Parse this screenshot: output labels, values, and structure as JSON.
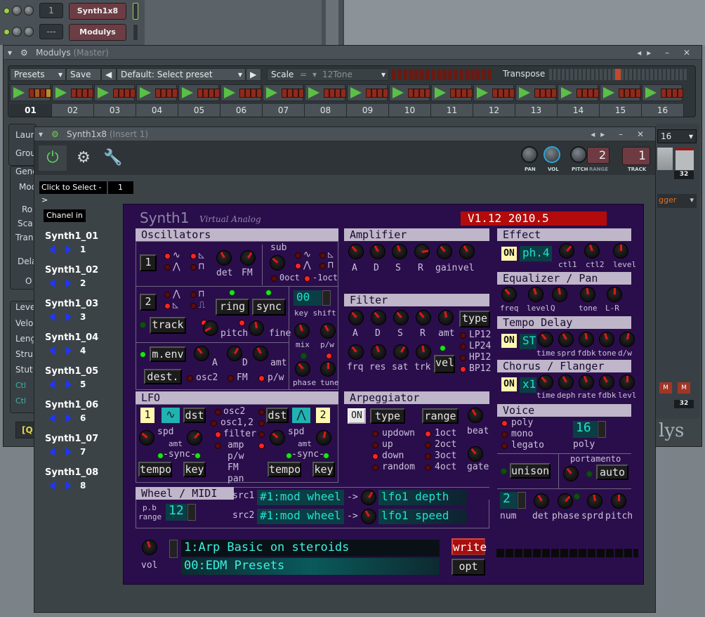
{
  "channel_rack": {
    "rows": [
      {
        "number": "1",
        "name": "Synth1x8"
      },
      {
        "number": "---",
        "name": "Modulys"
      }
    ]
  },
  "modulys_window": {
    "title": "Modulys",
    "title_suffix": "(Master)",
    "presets_label": "Presets",
    "save_label": "Save",
    "preset_name": "Default: Select preset",
    "scale_label": "Scale",
    "scale_value": "12Tone",
    "scale_eq": "=",
    "transpose_label": "Transpose",
    "tabs": [
      "01",
      "02",
      "03",
      "04",
      "05",
      "06",
      "07",
      "08",
      "09",
      "10",
      "11",
      "12",
      "13",
      "14",
      "15",
      "16"
    ],
    "left_labels": [
      "Laun",
      "Grou",
      "Gene",
      "Mod",
      "Ro",
      "Sca",
      "Tran",
      "Dela",
      "O",
      "Leve",
      "Velo",
      "Leng",
      "Stru",
      "Stut",
      "Ctl",
      "Ctl",
      "[Q"
    ],
    "right_panel": {
      "value": "16",
      "mini_num": "32",
      "mini_num2": "32",
      "trigger_text": "gger",
      "logo_fragment": "lys",
      "m_label": "M"
    }
  },
  "synth_window": {
    "title": "Synth1x8",
    "title_suffix": "(Insert 1)",
    "toolbar": {
      "pan_label": "PAN",
      "vol_label": "VOL",
      "pitch_label": "PITCH",
      "range_label": "RANGE",
      "range_value": "2",
      "track_label": "TRACK",
      "track_value": "1"
    },
    "click_to_select": "Click to Select ->",
    "select_value": "1",
    "chanel_in": "Chanel in",
    "channels": [
      {
        "name": "Synth1_01",
        "num": "1"
      },
      {
        "name": "Synth1_02",
        "num": "2"
      },
      {
        "name": "Synth1_03",
        "num": "3"
      },
      {
        "name": "Synth1_04",
        "num": "4"
      },
      {
        "name": "Synth1_05",
        "num": "5"
      },
      {
        "name": "Synth1_06",
        "num": "6"
      },
      {
        "name": "Synth1_07",
        "num": "7"
      },
      {
        "name": "Synth1_08",
        "num": "8"
      }
    ]
  },
  "synth1": {
    "title": "Synth1",
    "subtitle": "Virtual Analog",
    "version": "V1.12 2010.5",
    "osc": {
      "title": "Oscillators",
      "osc1": "1",
      "osc2": "2",
      "sub": "sub",
      "det": "det",
      "fm": "FM",
      "oct0": "0oct",
      "octm1": "-1oct",
      "ring": "ring",
      "sync": "sync",
      "track": "track",
      "pitch": "pitch",
      "fine": "fine",
      "key_value": "00",
      "key_shift": "key shift",
      "mix": "mix",
      "pw": "p/w",
      "menv": "m.env",
      "a": "A",
      "d": "D",
      "amt": "amt",
      "dest": "dest.",
      "osc2_opt": "osc2",
      "fm_opt": "FM",
      "pw_opt": "p/w",
      "phase": "phase",
      "tune": "tune"
    },
    "amp": {
      "title": "Amplifier",
      "labels": [
        "A",
        "D",
        "S",
        "R",
        "gain",
        "vel"
      ]
    },
    "filter": {
      "title": "Filter",
      "labels": [
        "A",
        "D",
        "S",
        "R",
        "amt"
      ],
      "type": "type",
      "labels2": [
        "frq",
        "res",
        "sat",
        "trk"
      ],
      "vel": "vel",
      "types": [
        "LP12",
        "LP24",
        "HP12",
        "BP12"
      ]
    },
    "effect": {
      "title": "Effect",
      "on": "ON",
      "type": "ph.4",
      "labels": [
        "ctl1",
        "ctl2",
        "level"
      ]
    },
    "eq": {
      "title": "Equalizer / Pan",
      "labels": [
        "freq",
        "level",
        "Q",
        "tone",
        "L-R"
      ]
    },
    "delay": {
      "title": "Tempo Delay",
      "on": "ON",
      "type": "ST",
      "labels": [
        "time",
        "sprd",
        "fdbk",
        "tone",
        "d/w"
      ]
    },
    "chorus": {
      "title": "Chorus / Flanger",
      "on": "ON",
      "type": "x1",
      "labels": [
        "time",
        "deph",
        "rate",
        "fdbk",
        "levl"
      ]
    },
    "lfo": {
      "title": "LFO",
      "lfo1": "1",
      "lfo2": "2",
      "dst": "dst",
      "spd": "spd",
      "amt": "amt",
      "sync": "-sync-",
      "tempo": "tempo",
      "key": "key",
      "dests": [
        "osc2",
        "osc1,2",
        "filter",
        "amp",
        "p/w",
        "FM",
        "pan"
      ]
    },
    "arp": {
      "title": "Arpeggiator",
      "on": "ON",
      "type": "type",
      "range": "range",
      "beat": "beat",
      "gate": "gate",
      "types": [
        "updown",
        "up",
        "down",
        "random"
      ],
      "ranges": [
        "1oct",
        "2oct",
        "3oct",
        "4oct"
      ]
    },
    "voice": {
      "title": "Voice",
      "modes": [
        "poly",
        "mono",
        "legato"
      ],
      "poly_value": "16",
      "poly_label": "poly",
      "unison": "unison",
      "portamento": "portamento",
      "auto": "auto",
      "num_value": "2",
      "num": "num",
      "labels": [
        "det",
        "phase",
        "sprd",
        "pitch"
      ]
    },
    "wheel": {
      "title": "Wheel / MIDI",
      "pb_range": "p.b",
      "range": "range",
      "pb_value": "12",
      "src1": "src1",
      "src2": "src2",
      "src1_value": "#1:mod wheel",
      "src2_value": "#1:mod wheel",
      "arrow": "->",
      "dst1": "lfo1 depth",
      "dst2": "lfo1 speed"
    },
    "bottom": {
      "vol": "vol",
      "patch": "1:Arp Basic on steroids",
      "bank": "00:EDM Presets",
      "write": "write",
      "opt": "opt"
    }
  },
  "colors": {
    "plugin_bg": "#2a0e4b",
    "section_header": "#bfb6c9",
    "red_led": "#ff2424",
    "green_led": "#1fe01f",
    "teal_text": "#23e0d0",
    "version_bg": "#b30b0b"
  }
}
